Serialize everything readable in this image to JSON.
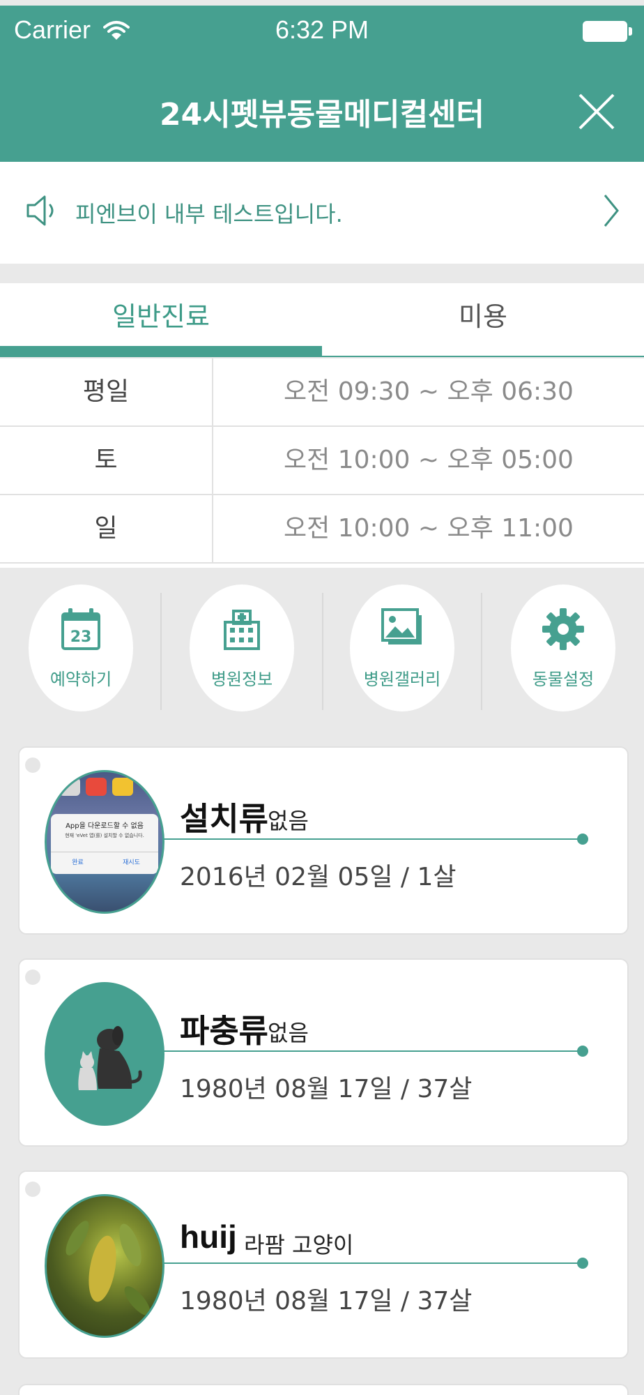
{
  "status_bar": {
    "carrier": "Carrier",
    "time": "6:32 PM"
  },
  "header": {
    "title": "24시펫뷰동물메디컬센터"
  },
  "notice": {
    "text": "피엔브이 내부 테스트입니다."
  },
  "tabs": [
    {
      "label": "일반진료",
      "active": true
    },
    {
      "label": "미용",
      "active": false
    }
  ],
  "hours": [
    {
      "day": "평일",
      "time": "오전 09:30 ~ 오후 06:30"
    },
    {
      "day": "토",
      "time": "오전 10:00 ~ 오후 05:00"
    },
    {
      "day": "일",
      "time": "오전 10:00 ~ 오후 11:00"
    }
  ],
  "menu": [
    {
      "label": "예약하기",
      "icon": "calendar-icon",
      "calendar_day": "23"
    },
    {
      "label": "병원정보",
      "icon": "hospital-icon"
    },
    {
      "label": "병원갤러리",
      "icon": "gallery-icon"
    },
    {
      "label": "동물설정",
      "icon": "gear-icon"
    }
  ],
  "pets": [
    {
      "name": "설치류",
      "breed": "없음",
      "birth": "2016년 02월 05일 / 1살",
      "avatar": "app-screenshot-photo",
      "avatar_dialog": {
        "title": "App을 다운로드할 수 없음",
        "message": "현재 'eVet 앱(를) 설치할 수 없습니다.",
        "btn_done": "완료",
        "btn_retry": "재시도"
      }
    },
    {
      "name": "파충류",
      "breed": "없음",
      "birth": "1980년 08월 17일 / 37살",
      "avatar": "dog-cat-icon"
    },
    {
      "name": "huij",
      "breed": "라팜 고양이",
      "birth": "1980년 08월 17일 / 37살",
      "avatar": "leaf-photo"
    }
  ],
  "colors": {
    "primary": "#46a090",
    "accent_text": "#3e9b88",
    "background": "#e9e9e9"
  }
}
